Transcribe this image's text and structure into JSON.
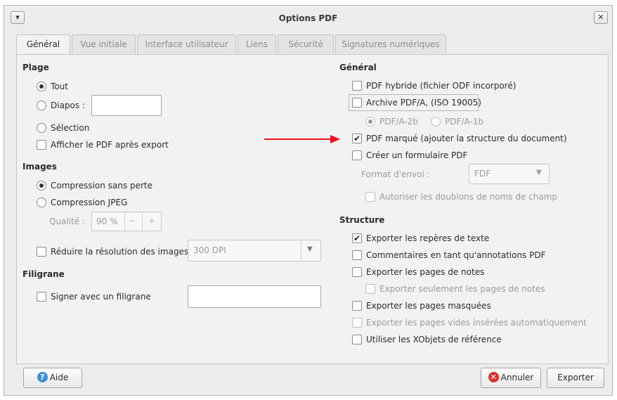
{
  "window": {
    "title": "Options PDF",
    "menu_icon": "chevron-down-icon",
    "close_icon": "close-icon"
  },
  "tabs": [
    "Général",
    "Vue initiale",
    "Interface utilisateur",
    "Liens",
    "Sécurité",
    "Signatures numériques"
  ],
  "left": {
    "range": {
      "heading": "Plage",
      "all": "Tout",
      "slides": "Diapos :",
      "selection": "Sélection",
      "view_after": "Afficher le PDF après export"
    },
    "images": {
      "heading": "Images",
      "lossless": "Compression sans perte",
      "jpeg": "Compression JPEG",
      "quality_label": "Qualité :",
      "quality_value": "90 %",
      "minus": "−",
      "plus": "+",
      "reduce": "Réduire la résolution des images",
      "dpi": "300 DPI"
    },
    "watermark": {
      "heading": "Filigrane",
      "sign": "Signer avec un filigrane"
    }
  },
  "right": {
    "general": {
      "heading": "Général",
      "hybrid": "PDF hybride (fichier ODF incorporé)",
      "archive": "Archive PDF/A, (ISO 19005)",
      "pdfa2b": "PDF/A-2b",
      "pdfa1b": "PDF/A-1b",
      "tagged": "PDF marqué (ajouter la structure du document)",
      "form": "Créer un formulaire PDF",
      "submit_label": "Format d'envoi :",
      "submit_value": "FDF",
      "dup_names": "Autoriser les doublons de noms de champ"
    },
    "structure": {
      "heading": "Structure",
      "bookmarks": "Exporter les repères de texte",
      "comments": "Commentaires en tant qu'annotations PDF",
      "notes": "Exporter les pages de notes",
      "notes_only": "Exporter seulement les pages de notes",
      "hidden": "Exporter les pages masquées",
      "blank": "Exporter les pages vides insérées automatiquement",
      "xobjects": "Utiliser les XObjets de référence"
    }
  },
  "buttons": {
    "help": "Aide",
    "cancel": "Annuler",
    "export": "Exporter"
  },
  "colors": {
    "arrow": "#e8141b",
    "help_icon": "#3b8fd6",
    "cancel_icon": "#d9322f"
  }
}
